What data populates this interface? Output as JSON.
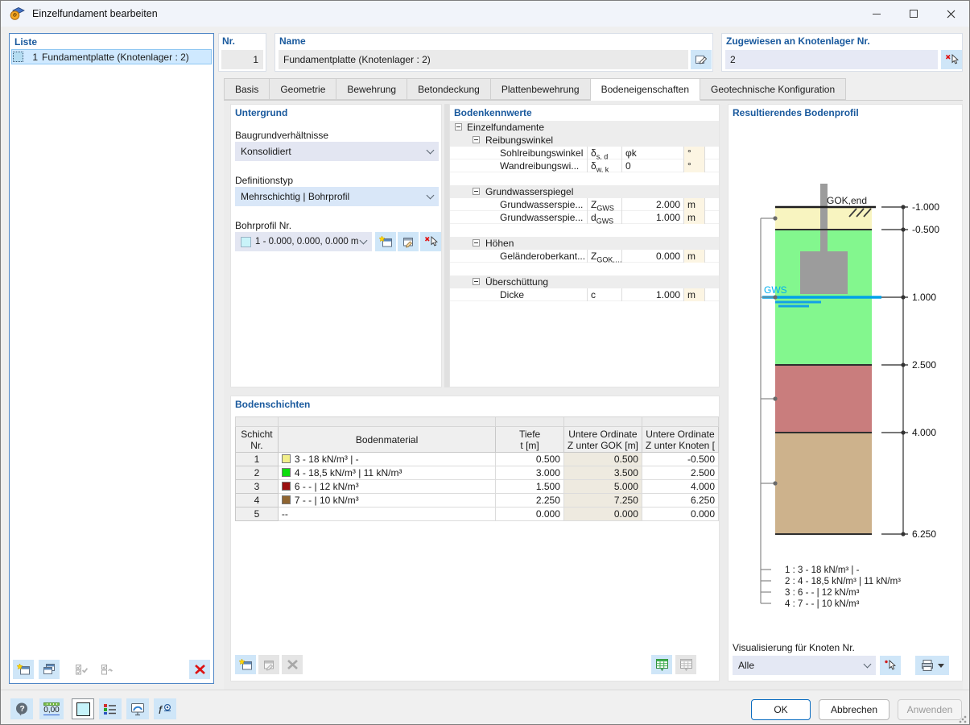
{
  "colors": {
    "accent_blue": "#19599d",
    "selection_blue": "#cfe9ff",
    "button_blue": "#cfe6f8",
    "gws_blue": "#00a2e8"
  },
  "window": {
    "title": "Einzelfundament bearbeiten"
  },
  "liste": {
    "title": "Liste",
    "item_nr": "1",
    "item_label": "Fundamentplatte (Knotenlager : 2)"
  },
  "header": {
    "nr_label": "Nr.",
    "nr_value": "1",
    "name_label": "Name",
    "name_value": "Fundamentplatte (Knotenlager : 2)",
    "assigned_label": "Zugewiesen an Knotenlager Nr.",
    "assigned_value": "2"
  },
  "tabs": [
    "Basis",
    "Geometrie",
    "Bewehrung",
    "Betondeckung",
    "Plattenbewehrung",
    "Bodeneigenschaften",
    "Geotechnische Konfiguration"
  ],
  "untergrund": {
    "title": "Untergrund",
    "baugrund_label": "Baugrundverhältnisse",
    "baugrund_value": "Konsolidiert",
    "deftyp_label": "Definitionstyp",
    "deftyp_value": "Mehrschichtig | Bohrprofil",
    "bohrprofil_label": "Bohrprofil Nr.",
    "bohrprofil_value": "1 - 0.000, 0.000, 0.000 m ...",
    "bohrprofil_swatch": "#c9f3f9"
  },
  "bodenkennwerte": {
    "title": "Bodenkennwerte",
    "root": "Einzelfundamente",
    "groups": [
      {
        "label": "Reibungswinkel",
        "rows": [
          {
            "label": "Sohlreibungswinkel",
            "sym_base": "δ",
            "sym_sub": "s, d",
            "value": "φk",
            "unit": "°"
          },
          {
            "label": "Wandreibungswi...",
            "sym_base": "δ",
            "sym_sub": "w, k",
            "value": "0",
            "unit": "°"
          }
        ]
      },
      {
        "label": "Grundwasserspiegel",
        "rows": [
          {
            "label": "Grundwasserspie...",
            "sym_base": "Z",
            "sym_sub": "GWS",
            "value": "2.000",
            "unit": "m"
          },
          {
            "label": "Grundwasserspie...",
            "sym_base": "d",
            "sym_sub": "GWS",
            "value": "1.000",
            "unit": "m"
          }
        ]
      },
      {
        "label": "Höhen",
        "rows": [
          {
            "label": "Geländeroberkant...",
            "sym_base": "Z",
            "sym_sub": "GOK,…",
            "value": "0.000",
            "unit": "m"
          }
        ]
      },
      {
        "label": "Überschüttung",
        "rows": [
          {
            "label": "Dicke",
            "sym_base": "c",
            "sym_sub": "",
            "value": "1.000",
            "unit": "m"
          }
        ]
      }
    ]
  },
  "bodenschichten": {
    "title": "Bodenschichten",
    "col_nr_1": "Schicht",
    "col_nr_2": "Nr.",
    "col_material": "Bodenmaterial",
    "col_tiefe_1": "Tiefe",
    "col_tiefe_2": "t [m]",
    "col_gok_1": "Untere Ordinate",
    "col_gok_2": "Z unter GOK [m]",
    "col_knoten_1": "Untere Ordinate",
    "col_knoten_2": "Z unter Knoten [",
    "rows": [
      {
        "nr": "1",
        "swatch": "#f2ef8a",
        "material": "3 - 18 kN/m³ | -",
        "tiefe": "0.500",
        "gok": "0.500",
        "knoten": "-0.500"
      },
      {
        "nr": "2",
        "swatch": "#0ddd0d",
        "material": "4 - 18,5 kN/m³ | 11 kN/m³",
        "tiefe": "3.000",
        "gok": "3.500",
        "knoten": "2.500"
      },
      {
        "nr": "3",
        "swatch": "#9b0f0f",
        "material": "6 - - | 12 kN/m³",
        "tiefe": "1.500",
        "gok": "5.000",
        "knoten": "4.000"
      },
      {
        "nr": "4",
        "swatch": "#8f6531",
        "material": "7 - - | 10 kN/m³",
        "tiefe": "2.250",
        "gok": "7.250",
        "knoten": "6.250"
      },
      {
        "nr": "5",
        "swatch": "",
        "material": "--",
        "tiefe": "0.000",
        "gok": "0.000",
        "knoten": "0.000"
      }
    ]
  },
  "profil": {
    "title": "Resultierendes Bodenprofil",
    "gok_label": "GOK,end",
    "gws_label": "GWS",
    "depth_marks": [
      "-1.000",
      "-0.500",
      "1.000",
      "2.500",
      "4.000",
      "6.250"
    ],
    "layers": [
      {
        "color": "#f8f4c0",
        "top": "-1.000",
        "bottom": "-0.500"
      },
      {
        "color": "#83f78e",
        "top": "-0.500",
        "bottom": "2.500"
      },
      {
        "color": "#c97d7d",
        "top": "2.500",
        "bottom": "4.000"
      },
      {
        "color": "#cdb28c",
        "top": "4.000",
        "bottom": "6.250"
      }
    ],
    "legend": [
      "1 :  3 - 18 kN/m³ | -",
      "2 :  4 - 18,5 kN/m³ | 11 kN/m³",
      "3 :  6 - - | 12 kN/m³",
      "4 :  7 - - | 10 kN/m³"
    ],
    "vis_label": "Visualisierung für Knoten Nr.",
    "vis_value": "Alle"
  },
  "footer": {
    "decimal_label": "0,00",
    "ok": "OK",
    "cancel": "Abbrechen",
    "apply": "Anwenden"
  }
}
